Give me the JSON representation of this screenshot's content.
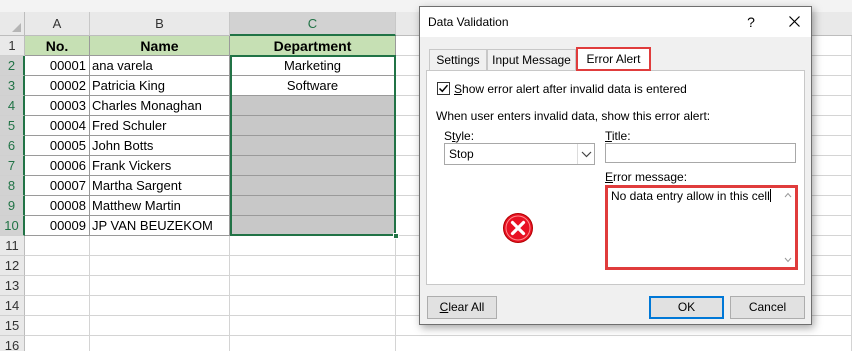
{
  "sheet": {
    "columns": [
      "A",
      "B",
      "C"
    ],
    "rows": [
      "1",
      "2",
      "3",
      "4",
      "5",
      "6",
      "7",
      "8",
      "9",
      "10",
      "11",
      "12",
      "13",
      "14",
      "15",
      "16"
    ],
    "headers": {
      "no": "No.",
      "name": "Name",
      "department": "Department"
    },
    "records": [
      {
        "no": "00001",
        "name": "ana varela",
        "dept": "Marketing"
      },
      {
        "no": "00002",
        "name": "Patricia King",
        "dept": "Software"
      },
      {
        "no": "00003",
        "name": "Charles Monaghan",
        "dept": ""
      },
      {
        "no": "00004",
        "name": "Fred Schuler",
        "dept": ""
      },
      {
        "no": "00005",
        "name": "John Botts",
        "dept": ""
      },
      {
        "no": "00006",
        "name": "Frank Vickers",
        "dept": ""
      },
      {
        "no": "00007",
        "name": "Martha Sargent",
        "dept": ""
      },
      {
        "no": "00008",
        "name": "Matthew Martin",
        "dept": ""
      },
      {
        "no": "00009",
        "name": "JP VAN BEUZEKOM",
        "dept": ""
      }
    ]
  },
  "dialog": {
    "title": "Data Validation",
    "help": "?",
    "tabs": [
      "Settings",
      "Input Message",
      "Error Alert"
    ],
    "active_tab": "Error Alert",
    "show_alert_checkbox": {
      "checked": true,
      "label": "Show error alert after invalid data is entered"
    },
    "instruction": "When user enters invalid data, show this error alert:",
    "style_label": "Style:",
    "style_value": "Stop",
    "title_label": "Title:",
    "title_value": "",
    "error_message_label": "Error message:",
    "error_message_value": "No data entry allow in this cell",
    "buttons": {
      "clear_all": "Clear All",
      "ok": "OK",
      "cancel": "Cancel"
    }
  },
  "colors": {
    "accent_green": "#217346",
    "header_green": "#c6e0b4",
    "highlight_red": "#e03c3c",
    "error_icon_red": "#e81123"
  }
}
